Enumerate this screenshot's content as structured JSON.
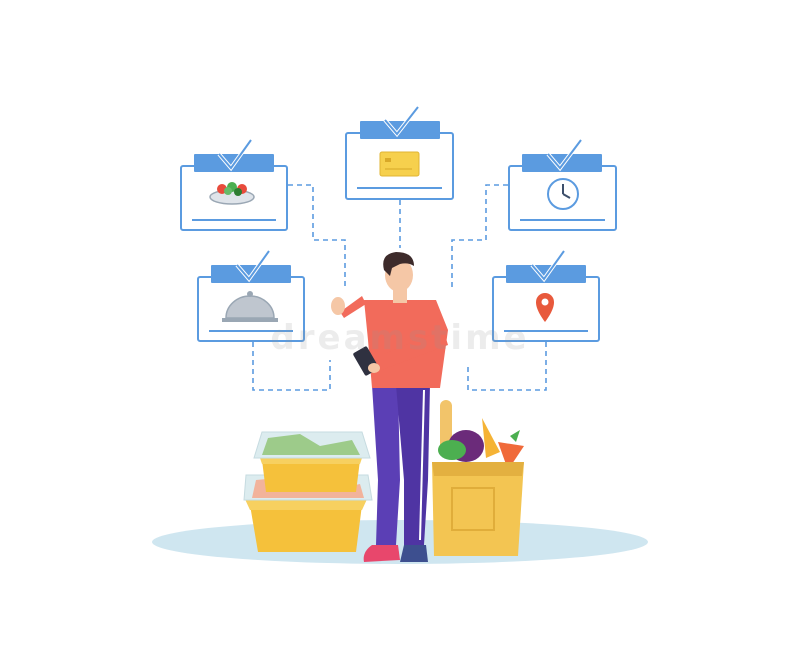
{
  "colors": {
    "card_border": "#5b9be0",
    "card_header": "#5b9be0",
    "connector": "#5b9be0",
    "ground": "#cfe6f0",
    "shirt": "#f26b5b",
    "pants": "#5b3fb5",
    "skin": "#f5c7a6",
    "hair": "#3d2b2b",
    "container": "#f5c13b",
    "bag": "#f3c552"
  },
  "cards": [
    {
      "id": "salad",
      "icon": "salad-bowl-icon"
    },
    {
      "id": "payment",
      "icon": "credit-card-icon"
    },
    {
      "id": "time",
      "icon": "clock-icon"
    },
    {
      "id": "dish",
      "icon": "serving-cloche-icon"
    },
    {
      "id": "location",
      "icon": "location-pin-icon"
    }
  ],
  "watermark": "dreamstime"
}
